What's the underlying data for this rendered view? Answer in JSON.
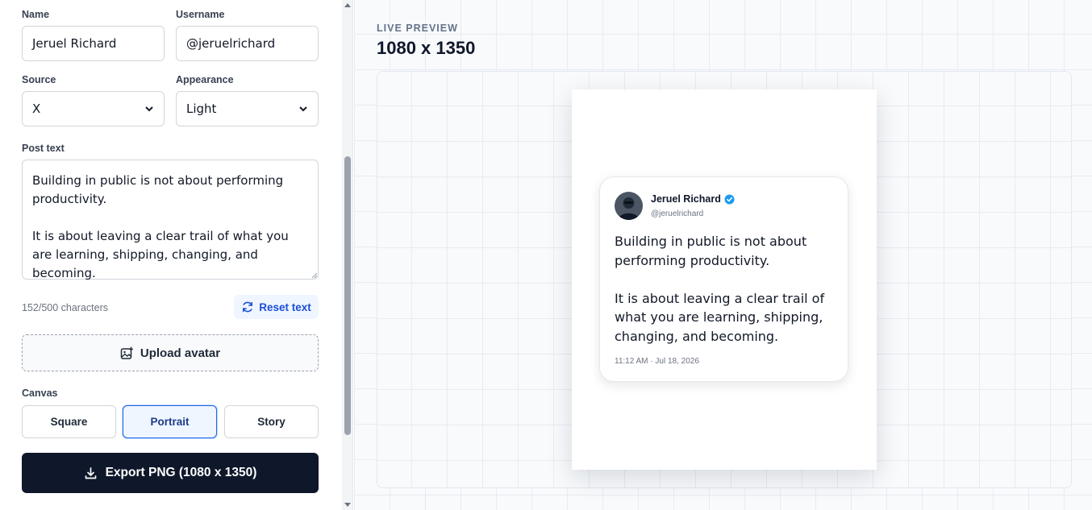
{
  "form": {
    "name_label": "Name",
    "name_value": "Jeruel Richard",
    "username_label": "Username",
    "username_value": "@jeruelrichard",
    "source_label": "Source",
    "source_value": "X",
    "appearance_label": "Appearance",
    "appearance_value": "Light",
    "post_label": "Post text",
    "post_value": "Building in public is not about performing productivity.\n\nIt is about leaving a clear trail of what you are learning, shipping, changing, and becoming.",
    "char_count": "152/500 characters",
    "reset_label": "Reset text",
    "upload_label": "Upload avatar",
    "canvas_label": "Canvas",
    "canvas_options": [
      "Square",
      "Portrait",
      "Story"
    ],
    "canvas_selected": "Portrait",
    "export_label": "Export PNG (1080 x 1350)"
  },
  "preview": {
    "label": "LIVE PREVIEW",
    "size": "1080 x 1350",
    "card": {
      "name": "Jeruel Richard",
      "handle": "@jeruelrichard",
      "text": "Building in public is not about performing productivity.\n\nIt is about leaving a clear trail of what you are learning, shipping, changing, and becoming.",
      "timestamp": "11:12 AM · Jul 18, 2026",
      "verified": true
    }
  },
  "colors": {
    "accent": "#2563eb",
    "primary_button": "#0f172a",
    "verified_badge": "#1d9bf0"
  }
}
